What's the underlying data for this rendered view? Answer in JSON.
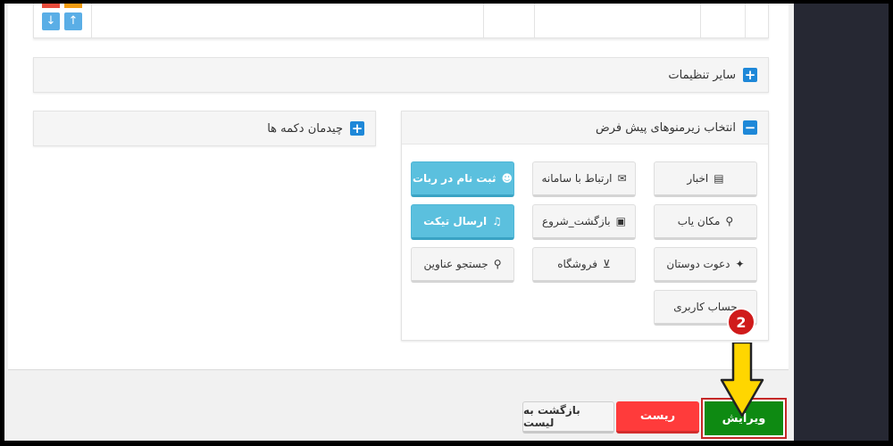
{
  "panels": {
    "other_settings": "سایر تنظیمات",
    "button_layout": "چیدمان دکمه ها",
    "default_submenus": "انتخاب زیرمنوهای پیش فرض"
  },
  "menu_buttons": [
    {
      "label": "اخبار",
      "icon": "newspaper-icon",
      "glyph": "▤"
    },
    {
      "label": "ارتباط با سامانه",
      "icon": "contact-icon",
      "glyph": "✉"
    },
    {
      "label": "ثبت نام در ربات",
      "icon": "users-icon",
      "glyph": "☻"
    },
    {
      "label": "مکان یاب",
      "icon": "search-icon",
      "glyph": "⚲"
    },
    {
      "label": "بازگشت_شروع",
      "icon": "return-icon",
      "glyph": "▣"
    },
    {
      "label": "ارسال تیکت",
      "icon": "bell-icon",
      "glyph": "♫"
    },
    {
      "label": "دعوت دوستان",
      "icon": "star-icon",
      "glyph": "✦"
    },
    {
      "label": "فروشگاه",
      "icon": "cart-icon",
      "glyph": "⊻"
    },
    {
      "label": "جستجو عناوین",
      "icon": "search-icon",
      "glyph": "⚲"
    },
    {
      "label": "حساب کاربری",
      "icon": "",
      "glyph": ""
    }
  ],
  "actions": {
    "back": "بازگشت به لیست",
    "reset": "ریست",
    "edit": "ویرایش"
  },
  "annotation": {
    "step": "2"
  },
  "arrows": {
    "down": "↓",
    "up": "↑"
  },
  "colors": {
    "edit": "#0e8a12",
    "reset": "#ff3b3b",
    "info": "#5bc0de",
    "accent": "#1e88d8",
    "highlight": "#ffd600"
  }
}
